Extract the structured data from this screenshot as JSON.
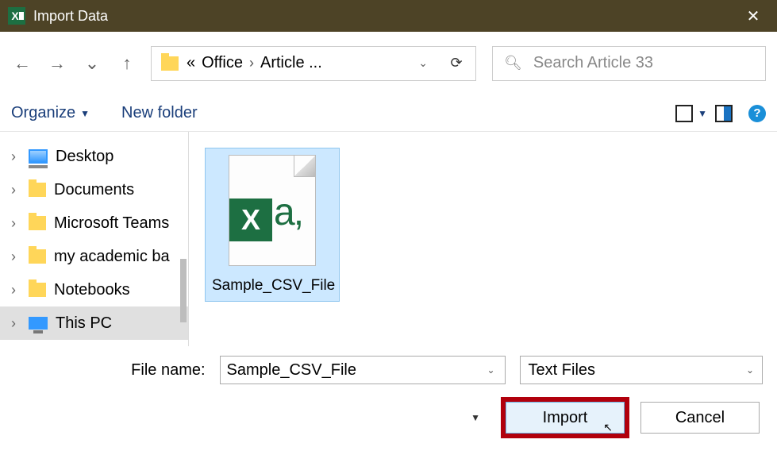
{
  "title": "Import Data",
  "nav": {
    "back": "←",
    "forward": "→",
    "history": "⌄",
    "up": "↑"
  },
  "address": {
    "prefix": "«",
    "crumbs": [
      "Office",
      "Article ..."
    ],
    "sep": "›"
  },
  "search": {
    "placeholder": "Search Article 33"
  },
  "toolbar": {
    "organize": "Organize",
    "newfolder": "New folder"
  },
  "tree": [
    {
      "label": "Desktop",
      "icon": "monitor"
    },
    {
      "label": "Documents",
      "icon": "folder"
    },
    {
      "label": "Microsoft Teams",
      "icon": "folder"
    },
    {
      "label": "my academic ba",
      "icon": "folder"
    },
    {
      "label": "Notebooks",
      "icon": "folder"
    },
    {
      "label": "This PC",
      "icon": "pc",
      "selected": true
    }
  ],
  "files": [
    {
      "label": "Sample_CSV_File",
      "badge": "X",
      "suffix": "a,"
    }
  ],
  "bottom": {
    "file_label": "File name:",
    "file_value": "Sample_CSV_File",
    "filter_value": "Text Files",
    "import_label": "Import",
    "cancel_label": "Cancel"
  }
}
